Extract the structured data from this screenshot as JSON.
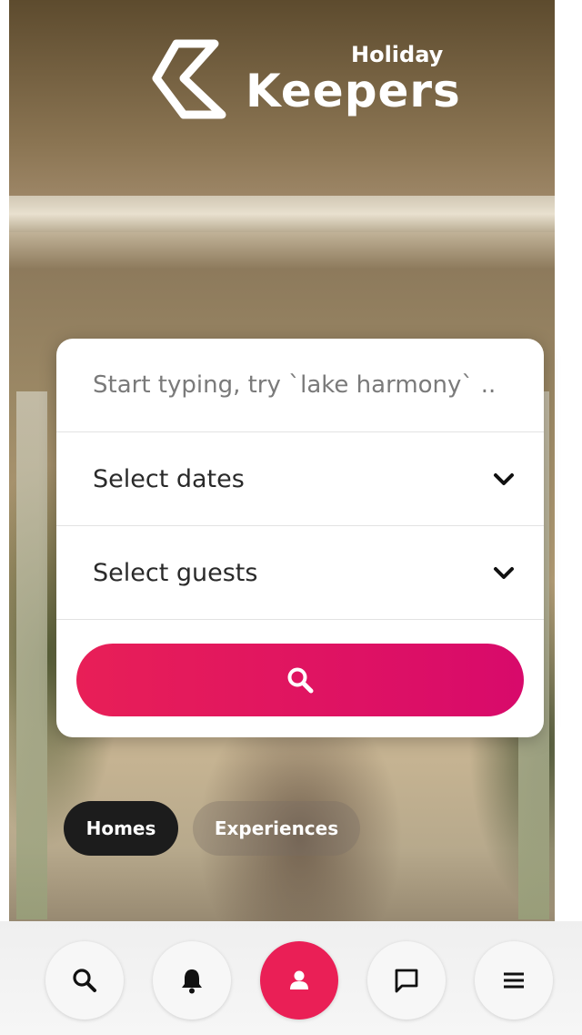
{
  "brand": {
    "line1": "Holiday",
    "line2": "Keepers"
  },
  "search": {
    "location_placeholder": "Start typing, try `lake harmony` ..",
    "dates_label": "Select dates",
    "guests_label": "Select guests",
    "submit_icon": "search-icon"
  },
  "tabs": [
    {
      "label": "Homes",
      "selected": true
    },
    {
      "label": "Experiences",
      "selected": false
    }
  ],
  "bottom_nav": [
    {
      "icon": "search-icon"
    },
    {
      "icon": "bell-icon"
    },
    {
      "icon": "user-icon",
      "active": true
    },
    {
      "icon": "chat-icon"
    },
    {
      "icon": "menu-icon"
    }
  ],
  "colors": {
    "accent": "#ea1f56",
    "accent_end": "#d80a6b",
    "tab_selected": "#1c1c1c"
  }
}
